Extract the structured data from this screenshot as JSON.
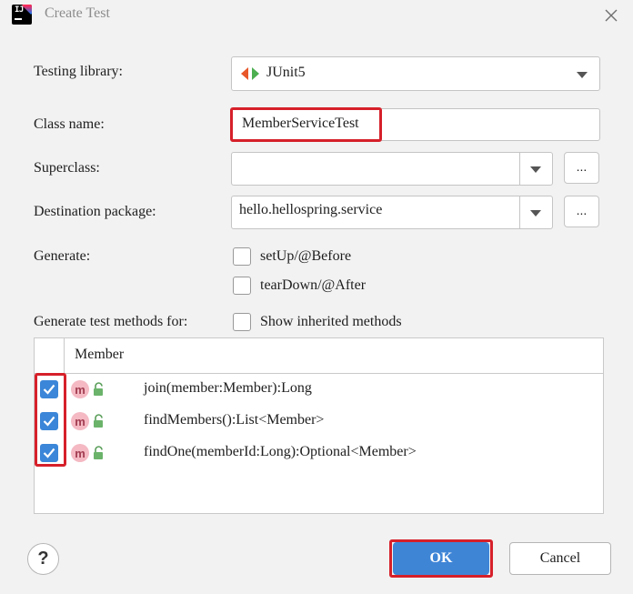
{
  "window": {
    "title": "Create Test"
  },
  "labels": {
    "testing_library": "Testing library:",
    "class_name": "Class name:",
    "superclass": "Superclass:",
    "destination_package": "Destination package:",
    "generate": "Generate:",
    "generate_methods_for": "Generate test methods for:"
  },
  "fields": {
    "testing_library": "JUnit5",
    "class_name": "MemberServiceTest",
    "superclass": "",
    "destination_package": "hello.hellospring.service",
    "browse_label": "..."
  },
  "generate_options": [
    {
      "label": "setUp/@Before",
      "checked": false
    },
    {
      "label": "tearDown/@After",
      "checked": false
    }
  ],
  "show_inherited": {
    "label": "Show inherited methods",
    "checked": false
  },
  "table": {
    "header": "Member",
    "rows": [
      {
        "checked": true,
        "badge": "m",
        "signature": "join(member:Member):Long"
      },
      {
        "checked": true,
        "badge": "m",
        "signature": "findMembers():List<Member>"
      },
      {
        "checked": true,
        "badge": "m",
        "signature": "findOne(memberId:Long):Optional<Member>"
      }
    ]
  },
  "buttons": {
    "help": "?",
    "ok": "OK",
    "cancel": "Cancel"
  },
  "colors": {
    "accent": "#3f85d6",
    "highlight": "#d6202a",
    "method_badge": "#f4b9c3"
  }
}
